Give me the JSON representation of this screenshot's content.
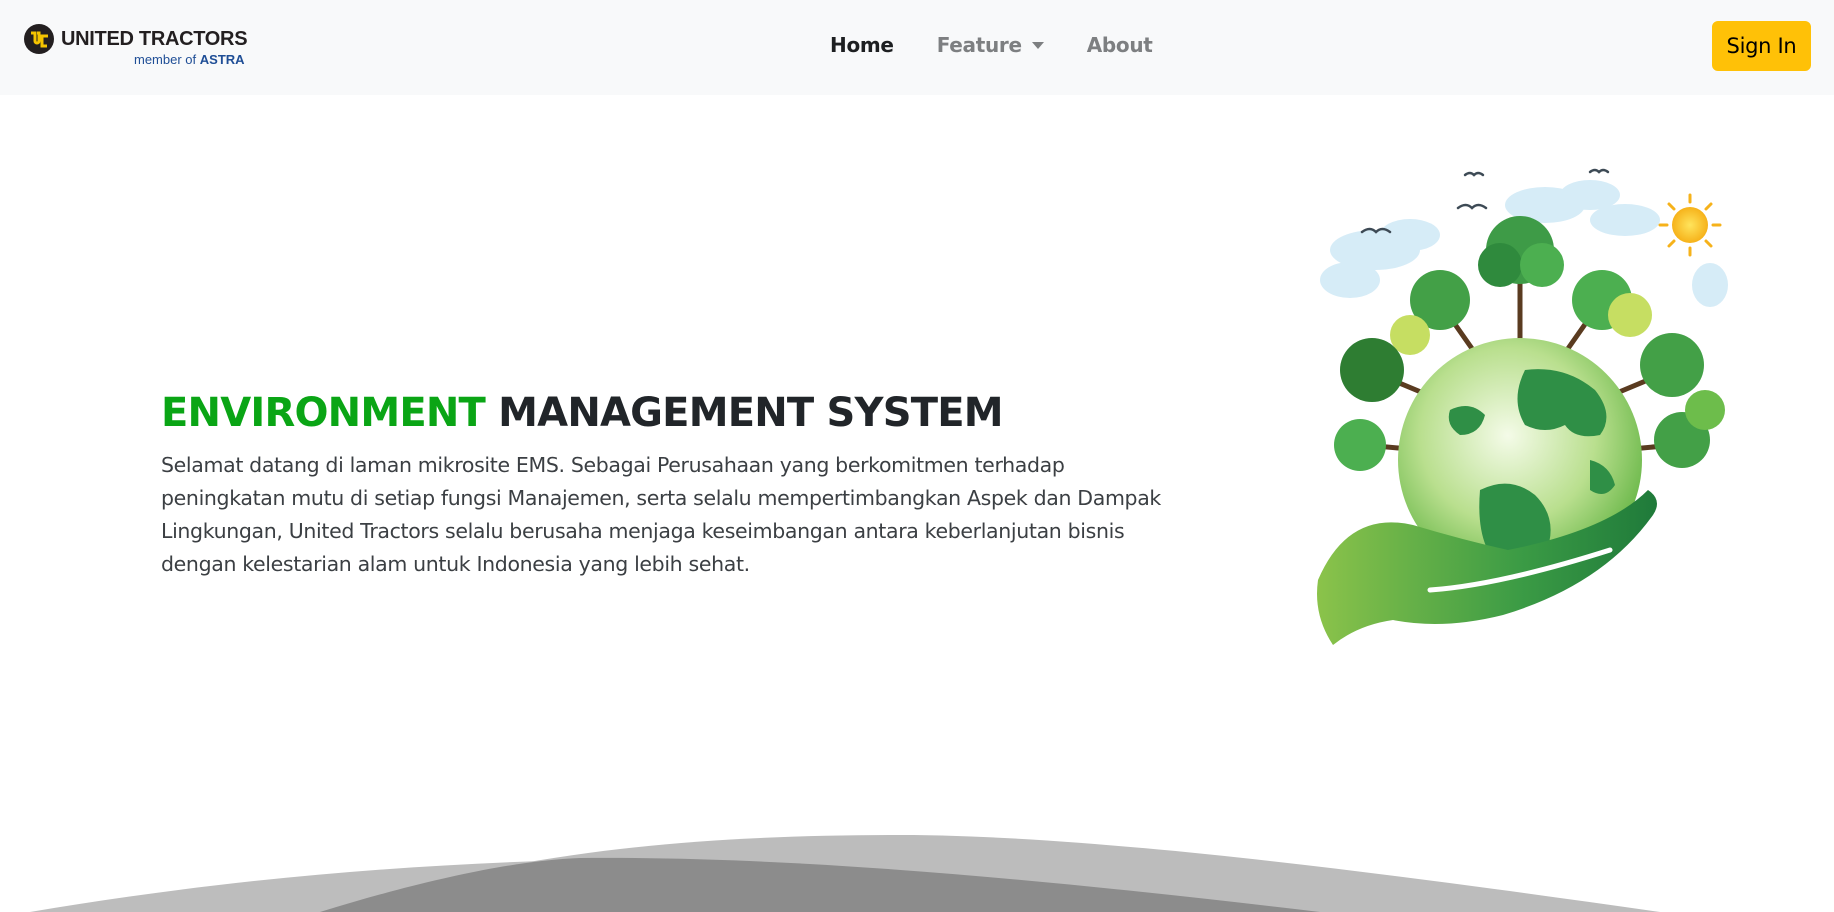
{
  "navbar": {
    "brand": {
      "name": "UNITED TRACTORS",
      "sub_prefix": "member of",
      "sub_brand": "ASTRA",
      "logo_icon": "ut-logo-icon"
    },
    "links": [
      {
        "label": "Home",
        "active": true
      },
      {
        "label": "Feature",
        "dropdown": true
      },
      {
        "label": "About"
      }
    ],
    "signin_label": "Sign In"
  },
  "hero": {
    "title_accent": "ENVIRONMENT",
    "title_rest": "MANAGEMENT SYSTEM",
    "description": "Selamat datang di laman mikrosite EMS. Sebagai Perusahaan yang berkomitmen terhadap peningkatan mutu di setiap fungsi Manajemen, serta selalu mempertimbangkan Aspek dan Dampak Lingkungan, United Tractors selalu berusaha menjaga keseimbangan antara keberlanjutan bisnis dengan kelestarian alam untuk Indonesia yang lebih sehat.",
    "illustration": "green-earth-hand-illustration"
  },
  "colors": {
    "accent_green": "#0aa515",
    "signin_yellow": "#ffc107",
    "navbar_bg": "#f8f9fa",
    "wave_light": "#bdbdbd",
    "wave_dark": "#8c8c8c"
  }
}
